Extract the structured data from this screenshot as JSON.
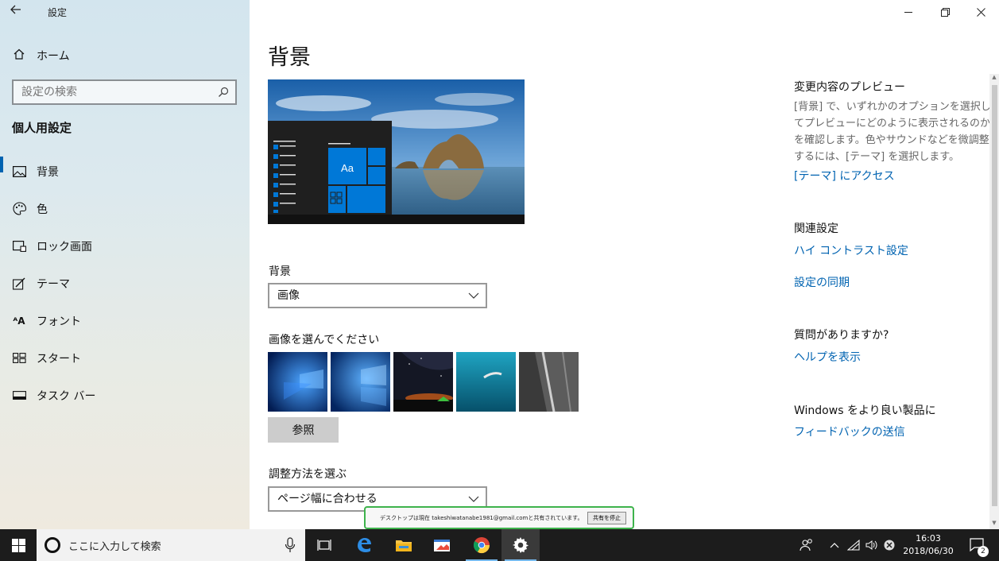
{
  "window": {
    "title": "設定"
  },
  "sidebar": {
    "home_label": "ホーム",
    "search_placeholder": "設定の検索",
    "section_title": "個人用設定",
    "items": [
      {
        "label": "背景",
        "icon": "picture-icon",
        "active": true
      },
      {
        "label": "色",
        "icon": "palette-icon"
      },
      {
        "label": "ロック画面",
        "icon": "lock-screen-icon"
      },
      {
        "label": "テーマ",
        "icon": "theme-brush-icon"
      },
      {
        "label": "フォント",
        "icon": "font-icon"
      },
      {
        "label": "スタート",
        "icon": "start-icon"
      },
      {
        "label": "タスク バー",
        "icon": "taskbar-icon"
      }
    ]
  },
  "main": {
    "title": "背景",
    "preview_tile_text": "Aa",
    "background_label": "背景",
    "background_value": "画像",
    "choose_picture_label": "画像を選んでください",
    "browse_label": "参照",
    "fit_label": "調整方法を選ぶ",
    "fit_value": "ページ幅に合わせる"
  },
  "right": {
    "preview_head": "変更内容のプレビュー",
    "preview_desc": "[背景] で、いずれかのオプションを選択してプレビューにどのように表示されるのかを確認します。色やサウンドなどを微調整するには、[テーマ] を選択します。",
    "theme_link": "[テーマ] にアクセス",
    "related_head": "関連設定",
    "contrast_link": "ハイ コントラスト設定",
    "sync_link": "設定の同期",
    "question_head": "質問がありますか?",
    "help_link": "ヘルプを表示",
    "windows_head": "Windows をより良い製品に",
    "feedback_link": "フィードバックの送信"
  },
  "share_banner": {
    "text": "デスクトップは現在 takeshiwatanabe1981@gmail.comと共有されています。",
    "stop_label": "共有を停止"
  },
  "taskbar": {
    "search_placeholder": "ここに入力して検索",
    "time": "16:03",
    "date": "2018/06/30",
    "notification_count": "2"
  },
  "colors": {
    "accent": "#0063b1",
    "taskbar": "#1c1c1c",
    "share_border": "#3eb34c"
  }
}
